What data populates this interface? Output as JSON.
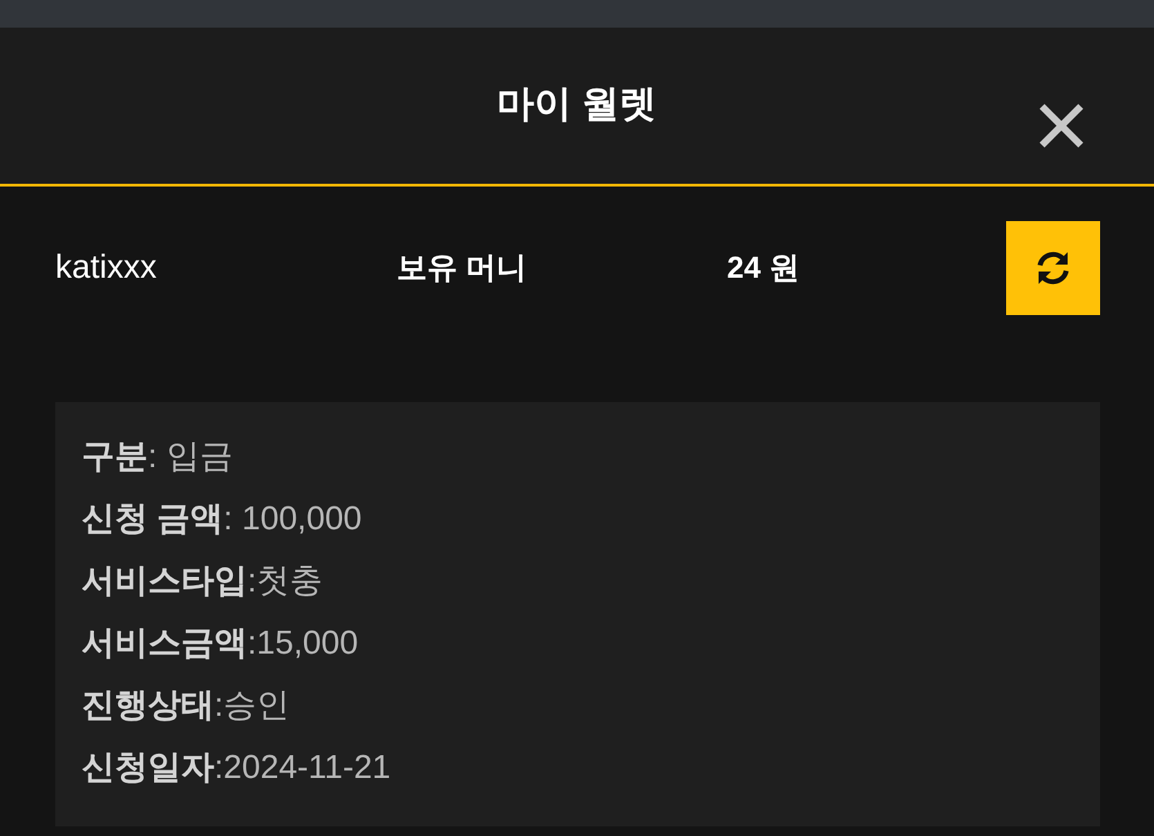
{
  "window": {
    "title": "마이 월렛"
  },
  "account": {
    "username": "katixxx",
    "balance_label": "보유 머니",
    "balance": "24 원"
  },
  "details": [
    "**구분**: 입금",
    "**신청 금액**: 100,000",
    "**서비스타입**:첫충",
    "**서비스금액**:15,000",
    "**진행상태**:승인",
    "**신청일자**:2024-11-21"
  ]
}
